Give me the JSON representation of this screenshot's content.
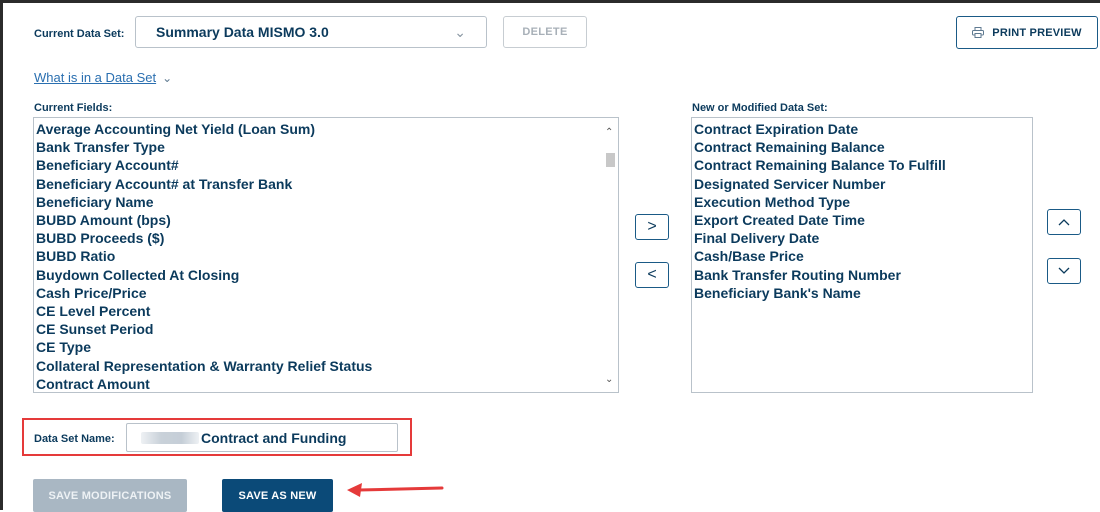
{
  "header": {
    "current_label": "Current Data Set:",
    "current_value": "Summary Data MISMO 3.0",
    "delete_label": "DELETE",
    "print_label": "PRINT PREVIEW"
  },
  "help_link": "What is in a Data Set",
  "current_fields": {
    "label": "Current Fields:",
    "items": [
      "Average Accounting Net Yield (Loan Sum)",
      "Bank Transfer Type",
      "Beneficiary Account#",
      "Beneficiary Account# at Transfer Bank",
      "Beneficiary Name",
      "BUBD Amount (bps)",
      "BUBD Proceeds ($)",
      "BUBD Ratio",
      "Buydown Collected At Closing",
      "Cash Price/Price",
      "CE Level Percent",
      "CE Sunset Period",
      "CE Type",
      "Collateral Representation & Warranty Relief Status",
      "Contract Amount"
    ]
  },
  "new_data_set": {
    "label": "New or Modified Data Set:",
    "items": [
      "Contract Expiration Date",
      "Contract Remaining Balance",
      "Contract Remaining Balance To Fulfill",
      "Designated Servicer Number",
      "Execution Method Type",
      "Export Created Date Time",
      "Final Delivery Date",
      "Cash/Base Price",
      "Bank Transfer Routing Number",
      "Beneficiary Bank's Name"
    ]
  },
  "controls": {
    "move_right": ">",
    "move_left": "<"
  },
  "data_set_name": {
    "label": "Data Set Name:",
    "value": "Contract and Funding"
  },
  "actions": {
    "save_modifications": "SAVE MODIFICATIONS",
    "save_as_new": "SAVE AS NEW"
  },
  "icons": {
    "print": "printer-icon",
    "chevron": "chevron-down-icon",
    "annotation": "red-arrow-icon"
  },
  "colors": {
    "primary": "#0b4a78",
    "text": "#0b3a5c",
    "link": "#2a6fb0",
    "highlight": "#e53a3a",
    "disabled": "#a9b7c3"
  }
}
